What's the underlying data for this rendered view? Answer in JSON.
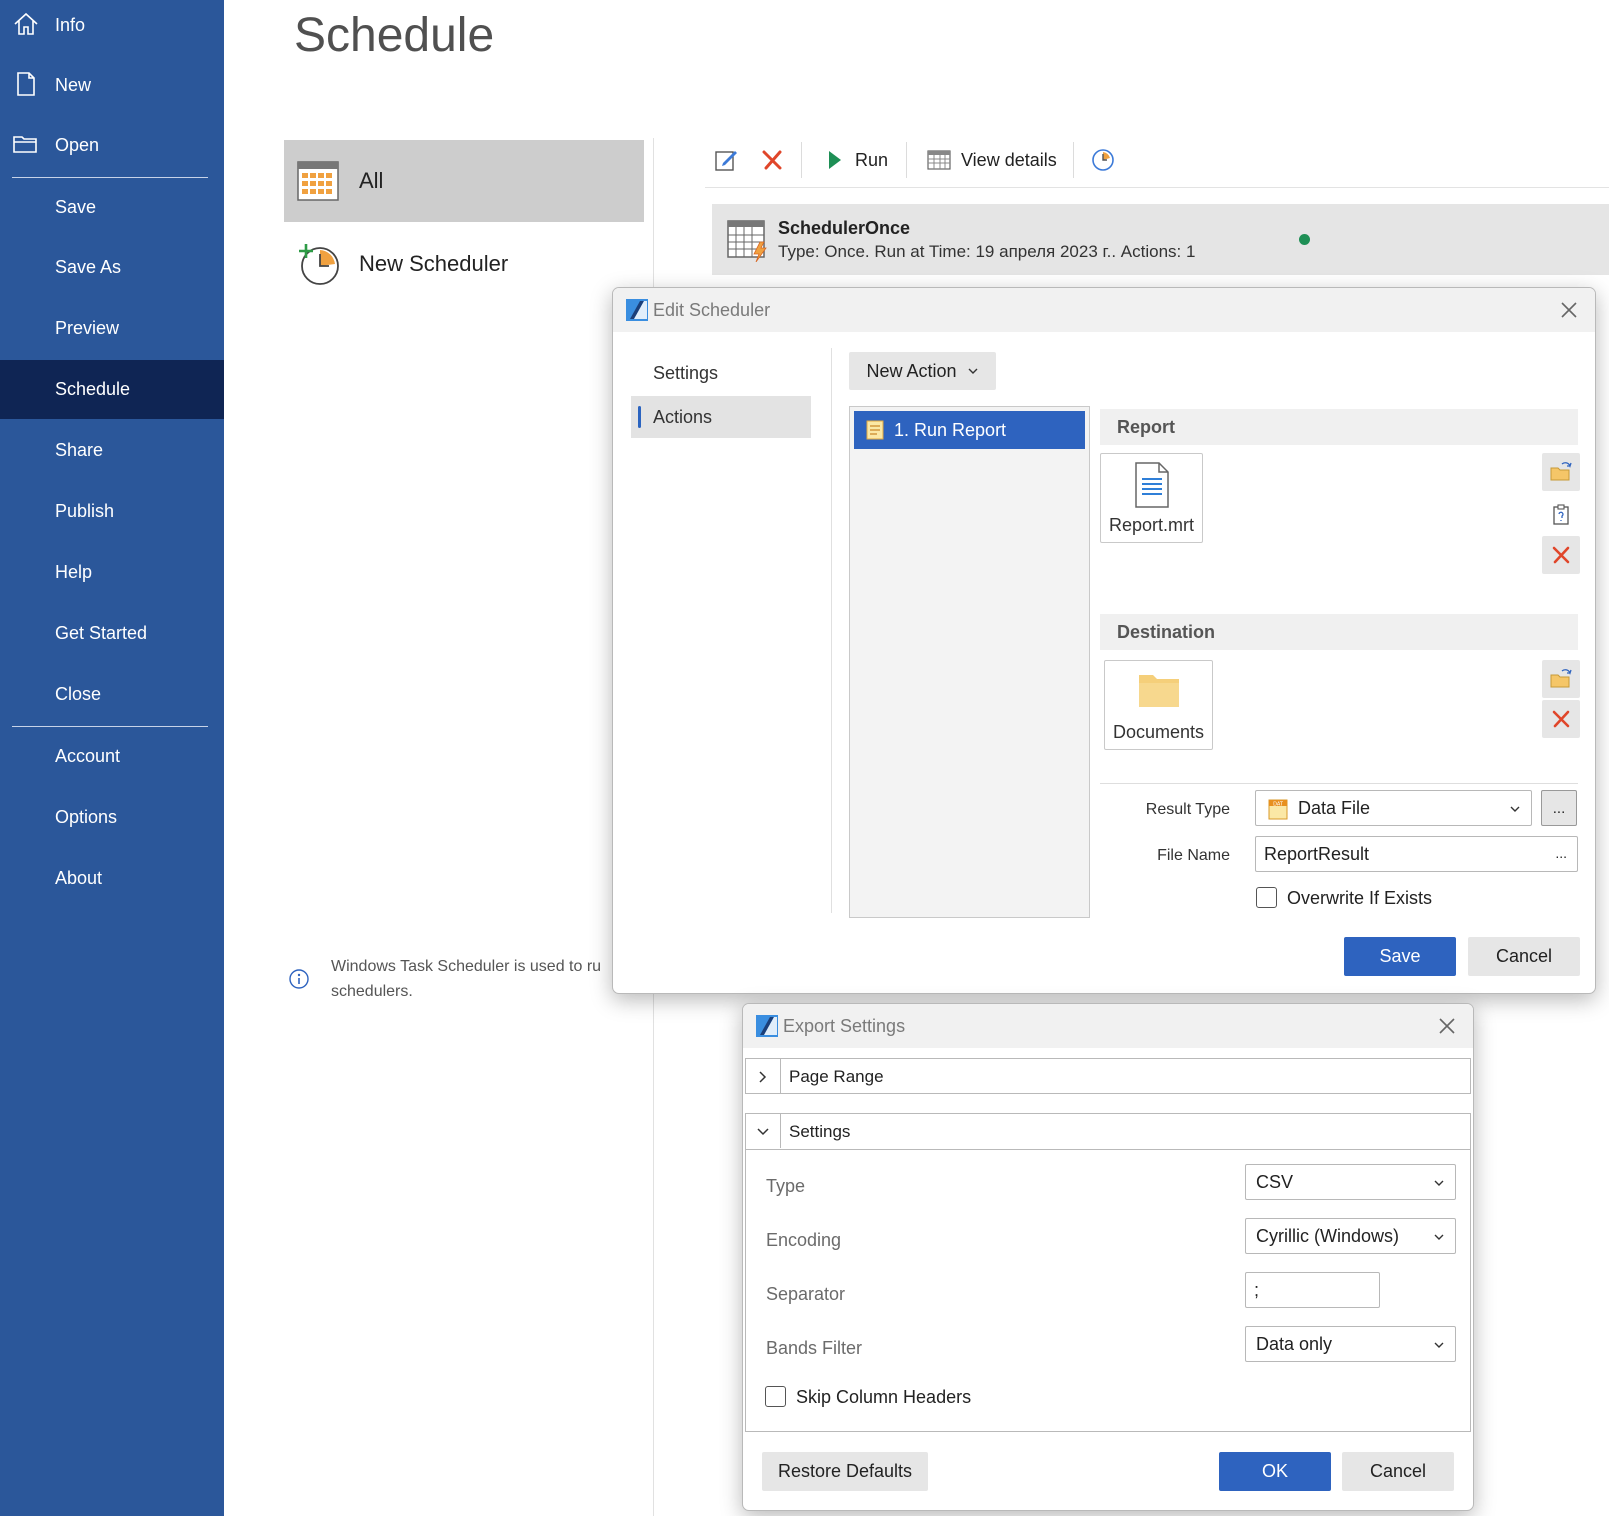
{
  "sidebar": {
    "items": [
      {
        "label": "Info",
        "icon": "home-icon"
      },
      {
        "label": "New",
        "icon": "new-file-icon"
      },
      {
        "label": "Open",
        "icon": "folder-icon"
      },
      {
        "label": "Save"
      },
      {
        "label": "Save As"
      },
      {
        "label": "Preview"
      },
      {
        "label": "Schedule"
      },
      {
        "label": "Share"
      },
      {
        "label": "Publish"
      },
      {
        "label": "Help"
      },
      {
        "label": "Get Started"
      },
      {
        "label": "Close"
      },
      {
        "label": "Account"
      },
      {
        "label": "Options"
      },
      {
        "label": "About"
      }
    ],
    "active": "Schedule",
    "bg_color": "#2b579a",
    "active_color": "#0f2554"
  },
  "page": {
    "title": "Schedule",
    "schedulers": {
      "all_label": "All",
      "new_label": "New Scheduler"
    },
    "toolbar": {
      "edit_icon": "edit-icon",
      "delete_icon": "delete-icon",
      "run_label": "Run",
      "view_details_label": "View details",
      "history_icon": "clock-icon"
    },
    "scheduler_row": {
      "name": "SchedulerOnce",
      "description": "Type: Once. Run at Time: 19 апреля 2023 г.. Actions: 1",
      "status_color": "#1e8f55"
    },
    "info": {
      "line1": "Windows Task Scheduler is used to ru",
      "line2": "schedulers."
    }
  },
  "edit_dialog": {
    "title": "Edit Scheduler",
    "nav": [
      "Settings",
      "Actions"
    ],
    "active_nav": "Actions",
    "new_action_label": "New Action",
    "actions": [
      "1. Run Report"
    ],
    "report_section": "Report",
    "report_file": "Report.mrt",
    "destination_section": "Destination",
    "destination_folder": "Documents",
    "result_type_label": "Result Type",
    "result_type_value": "Data File",
    "result_type_icon_text": "DAT",
    "browse_label": "...",
    "file_name_label": "File Name",
    "file_name_value": "ReportResult",
    "overwrite_label": "Overwrite If Exists",
    "overwrite_checked": false,
    "save_label": "Save",
    "cancel_label": "Cancel",
    "accent_color": "#2e63bf"
  },
  "export_dialog": {
    "title": "Export Settings",
    "page_range_label": "Page Range",
    "settings_label": "Settings",
    "fields": {
      "type_label": "Type",
      "type_value": "CSV",
      "encoding_label": "Encoding",
      "encoding_value": "Cyrillic (Windows)",
      "separator_label": "Separator",
      "separator_value": ";",
      "bands_filter_label": "Bands Filter",
      "bands_filter_value": "Data only"
    },
    "skip_headers_label": "Skip Column Headers",
    "skip_headers_checked": false,
    "restore_label": "Restore Defaults",
    "ok_label": "OK",
    "cancel_label": "Cancel"
  }
}
